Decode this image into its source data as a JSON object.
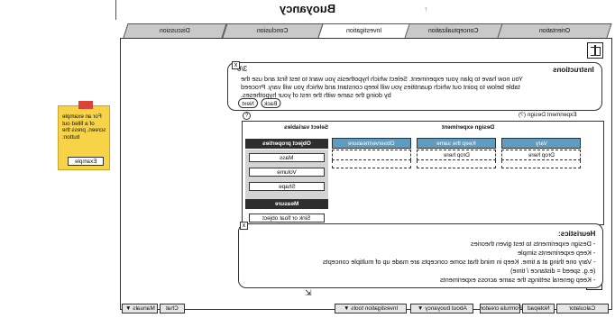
{
  "app": {
    "title": "Buoyancy"
  },
  "tabs": [
    {
      "label": "Orientation",
      "active": false
    },
    {
      "label": "Conceptualization",
      "active": false
    },
    {
      "label": "Investigation",
      "active": true
    },
    {
      "label": "Conclusion",
      "active": false
    },
    {
      "label": "Discussion",
      "active": false
    }
  ],
  "instructions": {
    "title": "Instructions",
    "step": "3/6",
    "lines": [
      "You now have to plan your experiment. Select which hypothesis you want to test first and use the",
      "table below to point out which quantities you will keep constant and which you will vary. Proceed",
      "by doing the same with the rest of your hypotheses."
    ],
    "back_label": "Back",
    "next_label": "Next",
    "close_label": "x"
  },
  "experiment": {
    "design_label": "Experiment Design (?)",
    "help_label": "?",
    "panel_title": "Design experiment",
    "columns": [
      {
        "header": "Vary",
        "drop": "Drop here"
      },
      {
        "header": "Keep the same",
        "drop": "Drop here"
      },
      {
        "header": "Observe/measure",
        "drop": ""
      }
    ]
  },
  "variables": {
    "title": "Select variables",
    "object_properties_label": "Object properties",
    "items": [
      "Mass",
      "Volume",
      "Shape"
    ],
    "measure_label": "Measure",
    "measure_items": [
      "Sink or float object"
    ]
  },
  "heuristics": {
    "title": "Heuristics:",
    "close_label": "x",
    "lines": [
      "- Design experiments to test given theories",
      "- Keep experiments simple",
      "- Vary one thing at a time. Keep in mind that some concepts are made up of multiple concepts",
      "(e.g. speed = distance / time)",
      "- Keep general settings the same across experiments"
    ]
  },
  "toolbar": {
    "items": [
      "Calculator",
      "Notepad",
      "Formula creator",
      "About buoyancy ▼",
      "Investigation tools ▼",
      "Chat",
      "Manuals ▼"
    ]
  },
  "note": {
    "text": "For an example of a filled out screen, press the button:",
    "button_label": "Example"
  },
  "colors": {
    "column_header": "#5f9cbf",
    "note": "#f7d348",
    "tape": "#d8433a",
    "dark_header": "#2e2e2e"
  }
}
